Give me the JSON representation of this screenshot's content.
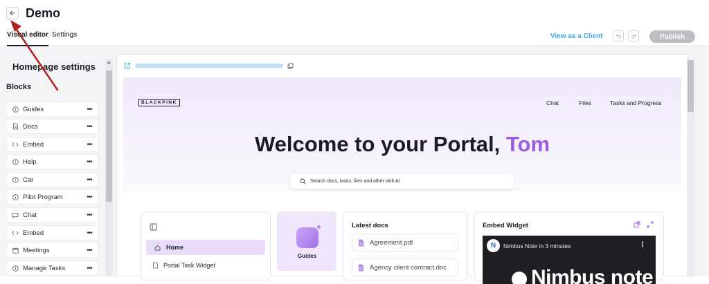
{
  "header": {
    "title": "Demo",
    "back_icon": "arrow-left-icon",
    "tabs": [
      {
        "label": "Visual editor",
        "active": true
      },
      {
        "label": "Settings",
        "active": false
      }
    ],
    "view_as_client_label": "View as a Client",
    "undo_icon": "undo-icon",
    "redo_icon": "redo-icon",
    "publish_label": "Publish"
  },
  "sidebar": {
    "title": "Homepage settings",
    "blocks_label": "Blocks",
    "blocks": [
      {
        "label": "Guides",
        "icon": "info-circle-icon"
      },
      {
        "label": "Docs",
        "icon": "document-icon"
      },
      {
        "label": "Embed",
        "icon": "code-icon"
      },
      {
        "label": "Help",
        "icon": "info-circle-icon"
      },
      {
        "label": "Car",
        "icon": "info-circle-icon"
      },
      {
        "label": "Pilot Program",
        "icon": "info-circle-icon"
      },
      {
        "label": "Chat",
        "icon": "chat-icon"
      },
      {
        "label": "Embed",
        "icon": "code-icon"
      },
      {
        "label": "Meetings",
        "icon": "calendar-icon"
      },
      {
        "label": "Manage Tasks",
        "icon": "info-circle-icon"
      }
    ],
    "more_label": "•••"
  },
  "preview": {
    "logo_text": "BLACKPINK",
    "nav": [
      "Chat",
      "Files",
      "Tasks and Progress"
    ],
    "welcome_prefix": "Welcome to your Portal, ",
    "welcome_name": "Tom",
    "search_placeholder": "Search docs, tasks, files and other with AI",
    "menu": {
      "home_label": "Home",
      "widget_label": "Portal Task Widget"
    },
    "guides_label": "Guides",
    "latest_docs": {
      "title": "Latest docs",
      "items": [
        "Agreement.pdf",
        "Agency client contract.doc"
      ]
    },
    "embed_widget": {
      "title": "Embed Widget",
      "video_title": "Nimbus Note in 3 minutes",
      "video_brand": "Nimbus note"
    }
  },
  "colors": {
    "accent_purple": "#9b5de5",
    "link_blue": "#3aa7e0",
    "publish_disabled": "#bdbdc4",
    "annotation_red": "#b3201a"
  }
}
